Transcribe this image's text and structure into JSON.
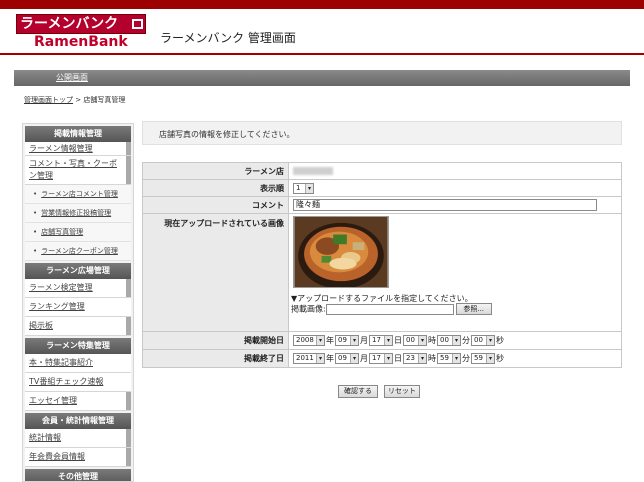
{
  "header": {
    "logo_jp": "ラーメンバンク",
    "logo_en": "RamenBank",
    "title": "ラーメンバンク 管理画面"
  },
  "nav": {
    "items": [
      "公開画面"
    ]
  },
  "breadcrumb": {
    "home": "管理画面トップ",
    "sep": ">",
    "current": "店舗写真管理"
  },
  "sidebar": {
    "sections": [
      {
        "title": "掲載情報管理",
        "items": [
          "ラーメン情報管理",
          "コメント・写真・クーポン管理"
        ],
        "sub": [
          "ラーメン店コメント管理",
          "営業情報修正投稿管理",
          "店舗写真管理",
          "ラーメン店クーポン管理"
        ]
      },
      {
        "title": "ラーメン広場管理",
        "items": [
          "ラーメン検定管理",
          "ランキング管理",
          "掲示板"
        ]
      },
      {
        "title": "ラーメン特集管理",
        "items": [
          "本・特集記事紹介",
          "TV番組チェック速報",
          "エッセイ管理"
        ]
      },
      {
        "title": "会員・統計情報管理",
        "items": [
          "統計情報",
          "年会費会員情報"
        ]
      },
      {
        "title": "その他管理",
        "items": []
      }
    ]
  },
  "notice": "店舗写真の情報を修正してください。",
  "form": {
    "shop_label": "ラーメン店",
    "order_label": "表示順",
    "order_value": "1",
    "comment_label": "コメント",
    "comment_value": "隆々麺",
    "image_label": "現在アップロードされている画像",
    "upload_note": "▼アップロードするファイルを指定してください。",
    "upload_label": "掲載画像:",
    "browse_label": "参照...",
    "start_label": "掲載開始日",
    "start": {
      "year": "2008",
      "month": "09",
      "day": "17",
      "hour": "00",
      "min": "00",
      "sec": "00"
    },
    "end_label": "掲載終了日",
    "end": {
      "year": "2011",
      "month": "09",
      "day": "17",
      "hour": "23",
      "min": "59",
      "sec": "59"
    },
    "units": {
      "year": "年",
      "month": "月",
      "day": "日",
      "hour": "時",
      "min": "分",
      "sec": "秒"
    }
  },
  "buttons": {
    "confirm": "確認する",
    "reset": "リセット"
  }
}
